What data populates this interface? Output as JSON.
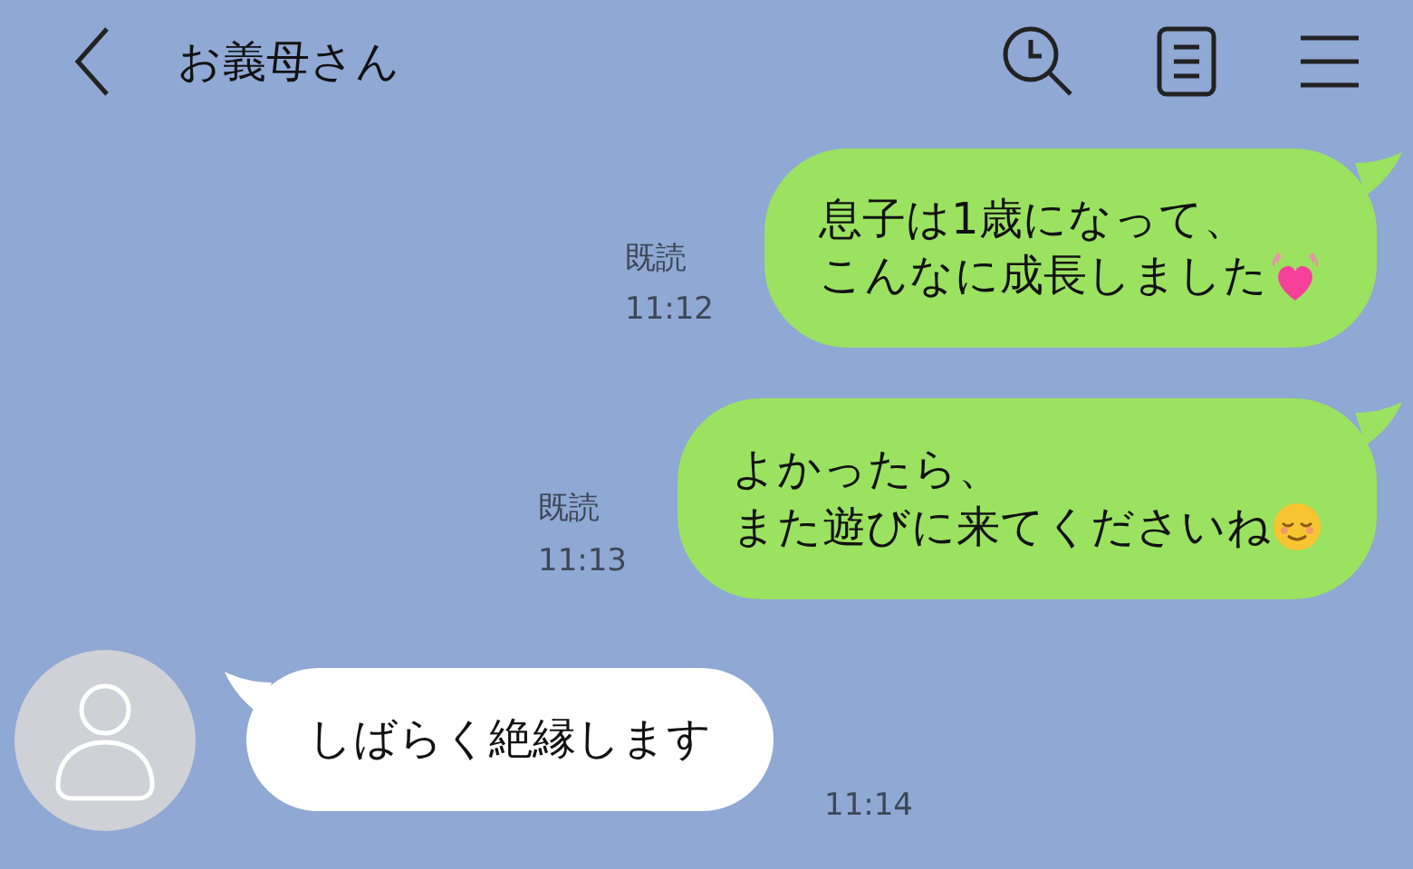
{
  "header": {
    "title": "お義母さん"
  },
  "messages": [
    {
      "kind": "sent",
      "lines": [
        "息子は1歳になって、",
        "こんなに成長しました"
      ],
      "read": "既読",
      "time": "11:12"
    },
    {
      "kind": "sent",
      "lines": [
        "よかったら、",
        "また遊びに来てくださいね"
      ],
      "read": "既読",
      "time": "11:13"
    },
    {
      "kind": "received",
      "lines": [
        "しばらく絶縁します"
      ],
      "time": "11:14"
    }
  ]
}
